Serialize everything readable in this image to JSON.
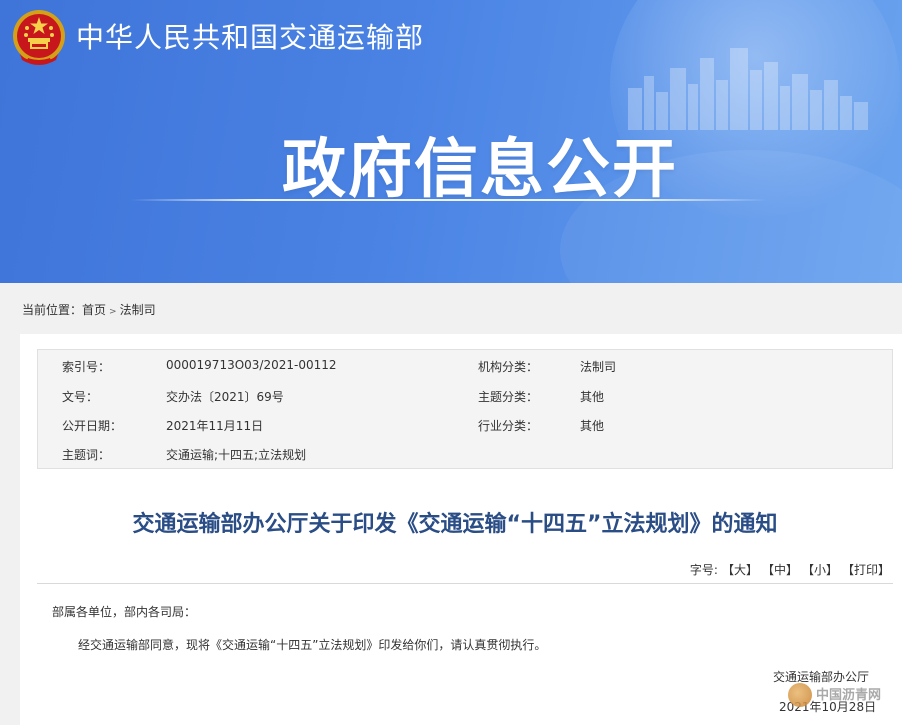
{
  "header": {
    "ministry": "中华人民共和国交通运输部",
    "banner_title": "政府信息公开"
  },
  "breadcrumb": {
    "prefix": "当前位置：",
    "home": "首页",
    "separator": ">",
    "current": "法制司"
  },
  "meta": {
    "index_label": "索引号：",
    "index_value": "000019713O03/2021-00112",
    "org_label": "机构分类：",
    "org_value": "法制司",
    "doc_no_label": "文号：",
    "doc_no_value": "交办法〔2021〕69号",
    "topic_label": "主题分类：",
    "topic_value": "其他",
    "date_label": "公开日期：",
    "date_value": "2021年11月11日",
    "industry_label": "行业分类：",
    "industry_value": "其他",
    "keywords_label": "主题词：",
    "keywords_value": "交通运输;十四五;立法规划"
  },
  "article": {
    "title": "交通运输部办公厅关于印发《交通运输“十四五”立法规划》的通知",
    "salutation": "部属各单位，部内各司局：",
    "body": "经交通运输部同意，现将《交通运输“十四五”立法规划》印发给你们，请认真贯彻执行。",
    "signature": "交通运输部办公厅",
    "date": "2021年10月28日"
  },
  "tools": {
    "font_label": "字号:",
    "large": "【大】",
    "medium": "【中】",
    "small": "【小】",
    "print": "【打印】"
  },
  "watermark": {
    "text": "中国沥青网"
  },
  "colors": {
    "banner": "#4a83e4",
    "title": "#2a4d86"
  }
}
